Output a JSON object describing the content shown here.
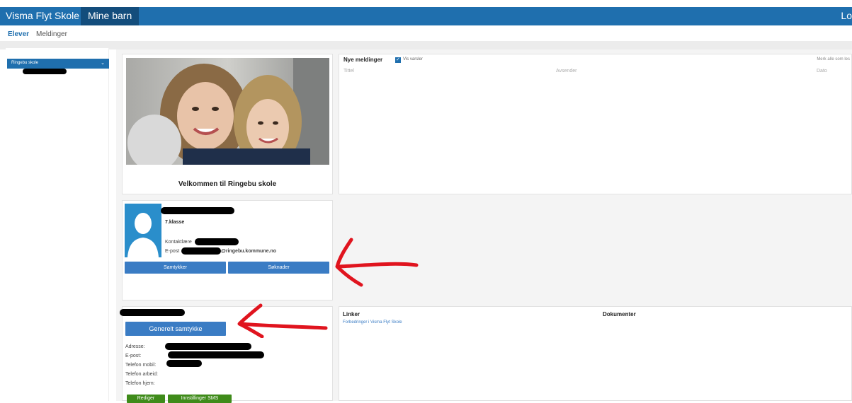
{
  "topbar": {
    "brand": "Visma Flyt Skole",
    "nav_item": "Mine barn",
    "right_text": "Lo"
  },
  "subnav": {
    "items": [
      "Elever",
      "Meldinger"
    ]
  },
  "sidebar": {
    "school_select": "Ringebu skole"
  },
  "welcome": {
    "text": "Velkommen til Ringebu skole"
  },
  "messages": {
    "heading": "Nye meldinger",
    "checkbox_label": "Vis varsler",
    "checkbox_checked": true,
    "mark_all_read": "Merk alle som les",
    "columns": [
      "Tittel",
      "Avsender",
      "Dato"
    ]
  },
  "student": {
    "class": "7.klasse",
    "contact_teacher_label": "Kontaktlære",
    "email_label": "E-post",
    "email_domain": "@ringebu.kommune.no",
    "buttons": [
      "Samtykker",
      "Søknader"
    ]
  },
  "guardian": {
    "consent_button": "Generelt samtykke",
    "fields": [
      "Adresse:",
      "E-post:",
      "Telefon mobil:",
      "Telefon arbeid:",
      "Telefon hjem:"
    ],
    "bottom_buttons": [
      "Rediger",
      "Innstillinger SMS"
    ]
  },
  "links": {
    "heading": "Linker",
    "documents_heading": "Dokumenter",
    "items": [
      "Forbedringer i Visma Flyt Skole"
    ]
  },
  "colors": {
    "topbar": "#1f6fae",
    "topnav_active": "#134d7c",
    "button_blue": "#3a7cc4",
    "button_green": "#3f8b1a",
    "annotation_red": "#e0141e"
  }
}
